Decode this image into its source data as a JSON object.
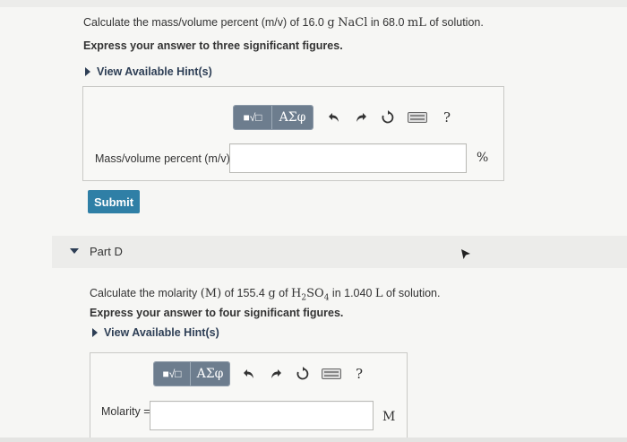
{
  "question1": {
    "prompt_prefix": "Calculate the mass/volume percent (m/v) of 16.0",
    "prompt_unit1": "g",
    "prompt_formula": "NaCl",
    "prompt_mid": "in 68.0",
    "prompt_unit2": "mL",
    "prompt_suffix": "of solution.",
    "instruction": "Express your answer to three significant figures.",
    "hint_label": "View Available Hint(s)",
    "toolbar": {
      "templates_label": "■√□",
      "symbols_label": "ΑΣφ",
      "help_label": "?"
    },
    "field_label": "Mass/volume percent (m/v) =",
    "field_value": "",
    "unit": "%",
    "submit_label": "Submit"
  },
  "partD": {
    "title": "Part D",
    "prompt_prefix": "Calculate the molarity",
    "prompt_sym": "(M)",
    "prompt_of": "of 155.4",
    "prompt_unit1": "g",
    "prompt_of2": "of",
    "prompt_formula_h": "H",
    "prompt_sub1": "2",
    "prompt_formula_so": "SO",
    "prompt_sub2": "4",
    "prompt_mid": "in 1.040",
    "prompt_unit2": "L",
    "prompt_suffix": "of solution.",
    "instruction": "Express your answer to four significant figures.",
    "hint_label": "View Available Hint(s)",
    "toolbar": {
      "templates_label": "■√□",
      "symbols_label": "ΑΣφ",
      "help_label": "?"
    },
    "field_label": "Molarity =",
    "field_value": "",
    "unit": "M"
  },
  "colors": {
    "submit": "#2f7fa6",
    "toolbar_button": "#6d7d8e",
    "hint_text": "#2d3e55"
  },
  "icons": [
    "undo-icon",
    "redo-icon",
    "reset-icon",
    "keyboard-icon",
    "help-icon",
    "cursor-icon"
  ]
}
